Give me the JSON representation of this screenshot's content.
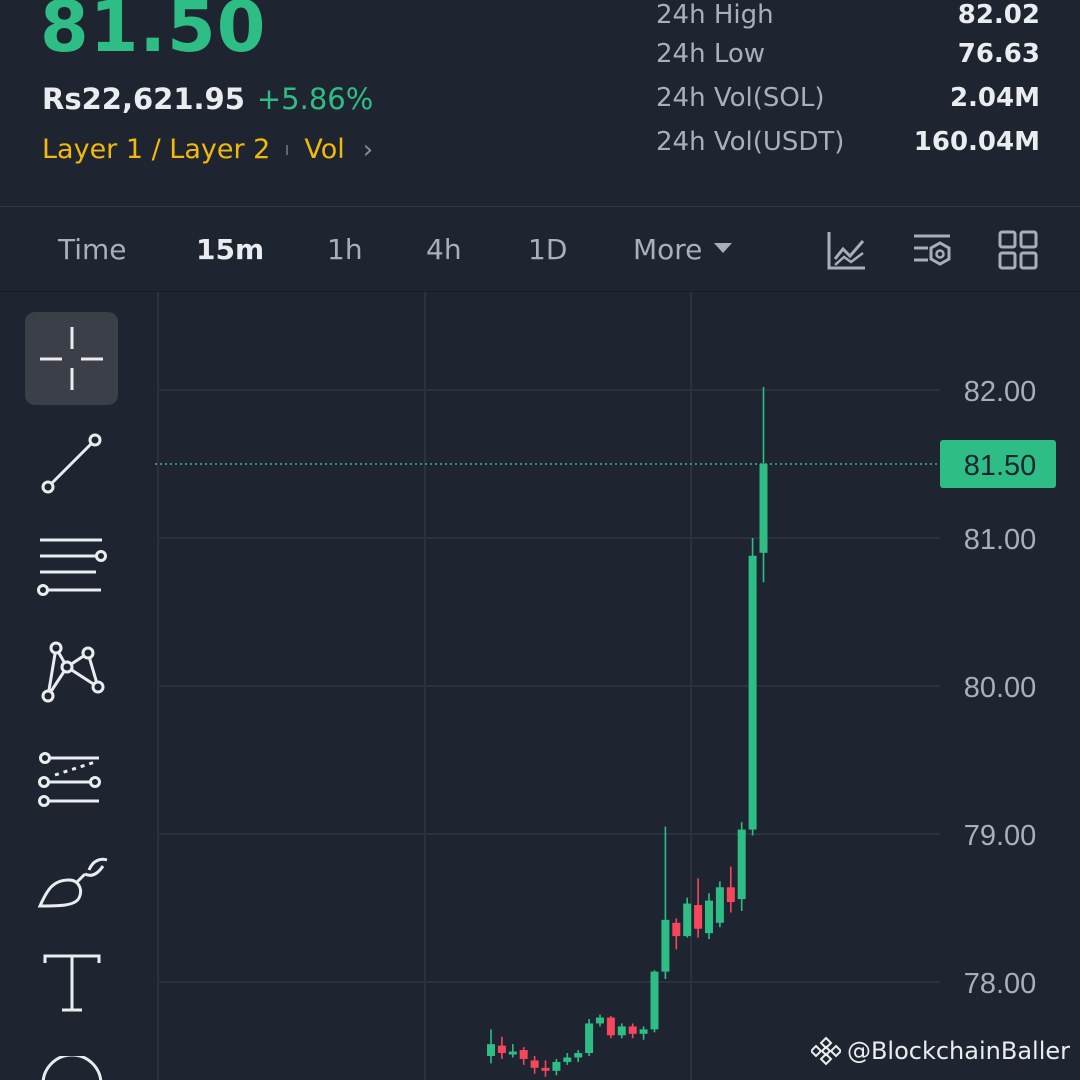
{
  "header": {
    "last_price": "81.50",
    "fiat_price": "Rs22,621.95",
    "change_pct": "+5.86%",
    "tags": "Layer 1 / Layer 2",
    "tag2": "Vol",
    "stats": [
      {
        "label": "24h High",
        "value": "82.02"
      },
      {
        "label": "24h Low",
        "value": "76.63"
      },
      {
        "label": "24h Vol(SOL)",
        "value": "2.04M"
      },
      {
        "label": "24h Vol(USDT)",
        "value": "160.04M"
      }
    ]
  },
  "toolbar": {
    "timeframes": [
      "Time",
      "15m",
      "1h",
      "4h",
      "1D"
    ],
    "active": "15m",
    "more_label": "More",
    "icons": [
      "indicator-chart-icon",
      "chart-settings-icon",
      "layout-grid-icon"
    ]
  },
  "tools": [
    "crosshair-icon",
    "trend-line-icon",
    "horizontal-lines-icon",
    "pattern-icon",
    "fib-channel-icon",
    "brush-icon",
    "text-tool-icon"
  ],
  "colors": {
    "up": "#2ebd85",
    "down": "#f6465d",
    "bg": "#1f2530",
    "accent": "#f0b90b"
  },
  "chart_data": {
    "type": "candlestick",
    "y_ticks": [
      "82.00",
      "81.00",
      "80.00",
      "79.00",
      "78.00"
    ],
    "last_price_label": "81.50",
    "last_price": 81.5,
    "candles": [
      {
        "o": 77.5,
        "h": 77.68,
        "l": 77.45,
        "c": 77.58
      },
      {
        "o": 77.57,
        "h": 77.63,
        "l": 77.48,
        "c": 77.52
      },
      {
        "o": 77.51,
        "h": 77.58,
        "l": 77.49,
        "c": 77.53
      },
      {
        "o": 77.54,
        "h": 77.56,
        "l": 77.44,
        "c": 77.48
      },
      {
        "o": 77.47,
        "h": 77.5,
        "l": 77.38,
        "c": 77.42
      },
      {
        "o": 77.42,
        "h": 77.47,
        "l": 77.36,
        "c": 77.4
      },
      {
        "o": 77.4,
        "h": 77.48,
        "l": 77.37,
        "c": 77.46
      },
      {
        "o": 77.46,
        "h": 77.52,
        "l": 77.44,
        "c": 77.49
      },
      {
        "o": 77.49,
        "h": 77.54,
        "l": 77.46,
        "c": 77.52
      },
      {
        "o": 77.52,
        "h": 77.75,
        "l": 77.5,
        "c": 77.72
      },
      {
        "o": 77.72,
        "h": 77.78,
        "l": 77.7,
        "c": 77.76
      },
      {
        "o": 77.76,
        "h": 77.77,
        "l": 77.62,
        "c": 77.64
      },
      {
        "o": 77.64,
        "h": 77.72,
        "l": 77.62,
        "c": 77.7
      },
      {
        "o": 77.7,
        "h": 77.72,
        "l": 77.62,
        "c": 77.65
      },
      {
        "o": 77.65,
        "h": 77.7,
        "l": 77.61,
        "c": 77.68
      },
      {
        "o": 77.68,
        "h": 78.08,
        "l": 77.66,
        "c": 78.07
      },
      {
        "o": 78.07,
        "h": 79.05,
        "l": 78.02,
        "c": 78.42
      },
      {
        "o": 78.4,
        "h": 78.43,
        "l": 78.22,
        "c": 78.31
      },
      {
        "o": 78.31,
        "h": 78.57,
        "l": 78.3,
        "c": 78.53
      },
      {
        "o": 78.52,
        "h": 78.7,
        "l": 78.3,
        "c": 78.36
      },
      {
        "o": 78.33,
        "h": 78.6,
        "l": 78.29,
        "c": 78.55
      },
      {
        "o": 78.4,
        "h": 78.68,
        "l": 78.37,
        "c": 78.64
      },
      {
        "o": 78.64,
        "h": 78.78,
        "l": 78.47,
        "c": 78.54
      },
      {
        "o": 78.56,
        "h": 79.08,
        "l": 78.48,
        "c": 79.03
      },
      {
        "o": 79.03,
        "h": 81.0,
        "l": 78.99,
        "c": 80.88
      },
      {
        "o": 80.9,
        "h": 82.02,
        "l": 80.7,
        "c": 81.5
      }
    ]
  },
  "watermark": "@BlockchainBaller"
}
